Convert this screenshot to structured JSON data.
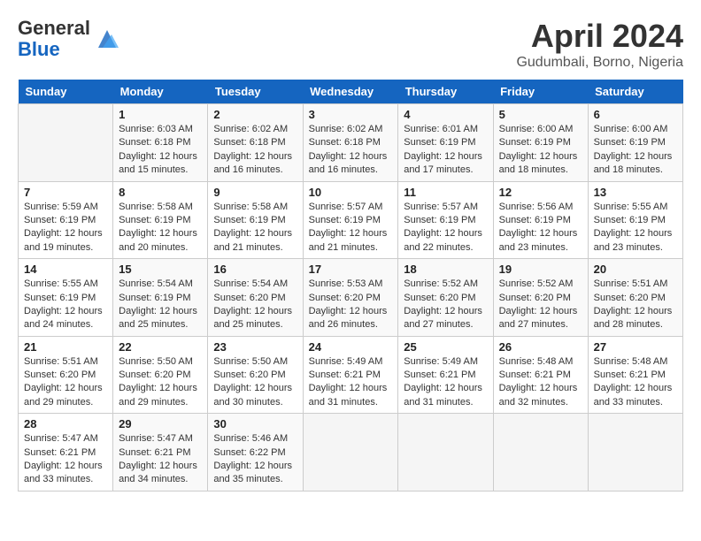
{
  "header": {
    "logo_general": "General",
    "logo_blue": "Blue",
    "month_title": "April 2024",
    "location": "Gudumbali, Borno, Nigeria"
  },
  "weekdays": [
    "Sunday",
    "Monday",
    "Tuesday",
    "Wednesday",
    "Thursday",
    "Friday",
    "Saturday"
  ],
  "weeks": [
    [
      {
        "day": "",
        "info": ""
      },
      {
        "day": "1",
        "info": "Sunrise: 6:03 AM\nSunset: 6:18 PM\nDaylight: 12 hours\nand 15 minutes."
      },
      {
        "day": "2",
        "info": "Sunrise: 6:02 AM\nSunset: 6:18 PM\nDaylight: 12 hours\nand 16 minutes."
      },
      {
        "day": "3",
        "info": "Sunrise: 6:02 AM\nSunset: 6:18 PM\nDaylight: 12 hours\nand 16 minutes."
      },
      {
        "day": "4",
        "info": "Sunrise: 6:01 AM\nSunset: 6:19 PM\nDaylight: 12 hours\nand 17 minutes."
      },
      {
        "day": "5",
        "info": "Sunrise: 6:00 AM\nSunset: 6:19 PM\nDaylight: 12 hours\nand 18 minutes."
      },
      {
        "day": "6",
        "info": "Sunrise: 6:00 AM\nSunset: 6:19 PM\nDaylight: 12 hours\nand 18 minutes."
      }
    ],
    [
      {
        "day": "7",
        "info": "Sunrise: 5:59 AM\nSunset: 6:19 PM\nDaylight: 12 hours\nand 19 minutes."
      },
      {
        "day": "8",
        "info": "Sunrise: 5:58 AM\nSunset: 6:19 PM\nDaylight: 12 hours\nand 20 minutes."
      },
      {
        "day": "9",
        "info": "Sunrise: 5:58 AM\nSunset: 6:19 PM\nDaylight: 12 hours\nand 21 minutes."
      },
      {
        "day": "10",
        "info": "Sunrise: 5:57 AM\nSunset: 6:19 PM\nDaylight: 12 hours\nand 21 minutes."
      },
      {
        "day": "11",
        "info": "Sunrise: 5:57 AM\nSunset: 6:19 PM\nDaylight: 12 hours\nand 22 minutes."
      },
      {
        "day": "12",
        "info": "Sunrise: 5:56 AM\nSunset: 6:19 PM\nDaylight: 12 hours\nand 23 minutes."
      },
      {
        "day": "13",
        "info": "Sunrise: 5:55 AM\nSunset: 6:19 PM\nDaylight: 12 hours\nand 23 minutes."
      }
    ],
    [
      {
        "day": "14",
        "info": "Sunrise: 5:55 AM\nSunset: 6:19 PM\nDaylight: 12 hours\nand 24 minutes."
      },
      {
        "day": "15",
        "info": "Sunrise: 5:54 AM\nSunset: 6:19 PM\nDaylight: 12 hours\nand 25 minutes."
      },
      {
        "day": "16",
        "info": "Sunrise: 5:54 AM\nSunset: 6:20 PM\nDaylight: 12 hours\nand 25 minutes."
      },
      {
        "day": "17",
        "info": "Sunrise: 5:53 AM\nSunset: 6:20 PM\nDaylight: 12 hours\nand 26 minutes."
      },
      {
        "day": "18",
        "info": "Sunrise: 5:52 AM\nSunset: 6:20 PM\nDaylight: 12 hours\nand 27 minutes."
      },
      {
        "day": "19",
        "info": "Sunrise: 5:52 AM\nSunset: 6:20 PM\nDaylight: 12 hours\nand 27 minutes."
      },
      {
        "day": "20",
        "info": "Sunrise: 5:51 AM\nSunset: 6:20 PM\nDaylight: 12 hours\nand 28 minutes."
      }
    ],
    [
      {
        "day": "21",
        "info": "Sunrise: 5:51 AM\nSunset: 6:20 PM\nDaylight: 12 hours\nand 29 minutes."
      },
      {
        "day": "22",
        "info": "Sunrise: 5:50 AM\nSunset: 6:20 PM\nDaylight: 12 hours\nand 29 minutes."
      },
      {
        "day": "23",
        "info": "Sunrise: 5:50 AM\nSunset: 6:20 PM\nDaylight: 12 hours\nand 30 minutes."
      },
      {
        "day": "24",
        "info": "Sunrise: 5:49 AM\nSunset: 6:21 PM\nDaylight: 12 hours\nand 31 minutes."
      },
      {
        "day": "25",
        "info": "Sunrise: 5:49 AM\nSunset: 6:21 PM\nDaylight: 12 hours\nand 31 minutes."
      },
      {
        "day": "26",
        "info": "Sunrise: 5:48 AM\nSunset: 6:21 PM\nDaylight: 12 hours\nand 32 minutes."
      },
      {
        "day": "27",
        "info": "Sunrise: 5:48 AM\nSunset: 6:21 PM\nDaylight: 12 hours\nand 33 minutes."
      }
    ],
    [
      {
        "day": "28",
        "info": "Sunrise: 5:47 AM\nSunset: 6:21 PM\nDaylight: 12 hours\nand 33 minutes."
      },
      {
        "day": "29",
        "info": "Sunrise: 5:47 AM\nSunset: 6:21 PM\nDaylight: 12 hours\nand 34 minutes."
      },
      {
        "day": "30",
        "info": "Sunrise: 5:46 AM\nSunset: 6:22 PM\nDaylight: 12 hours\nand 35 minutes."
      },
      {
        "day": "",
        "info": ""
      },
      {
        "day": "",
        "info": ""
      },
      {
        "day": "",
        "info": ""
      },
      {
        "day": "",
        "info": ""
      }
    ]
  ]
}
